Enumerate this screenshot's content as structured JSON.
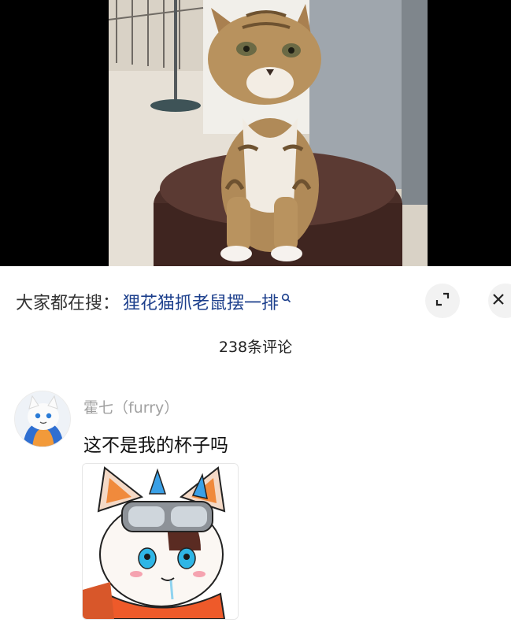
{
  "video": {
    "image_description_icon": "cat-video-frame"
  },
  "search_bar": {
    "prefix": "大家都在搜：",
    "term": "狸花猫抓老鼠摆一排",
    "icon": "search-icon",
    "term_color": "#1c3f8c"
  },
  "toolbar": {
    "expand_icon": "expand-icon",
    "close_icon": "close-icon"
  },
  "comments": {
    "count_label": "238条评论",
    "items": [
      {
        "username": "霍七（furry）",
        "text": "这不是我的杯子吗",
        "avatar_icon": "furry-avatar",
        "sticker_icon": "furry-character-sticker"
      }
    ]
  }
}
